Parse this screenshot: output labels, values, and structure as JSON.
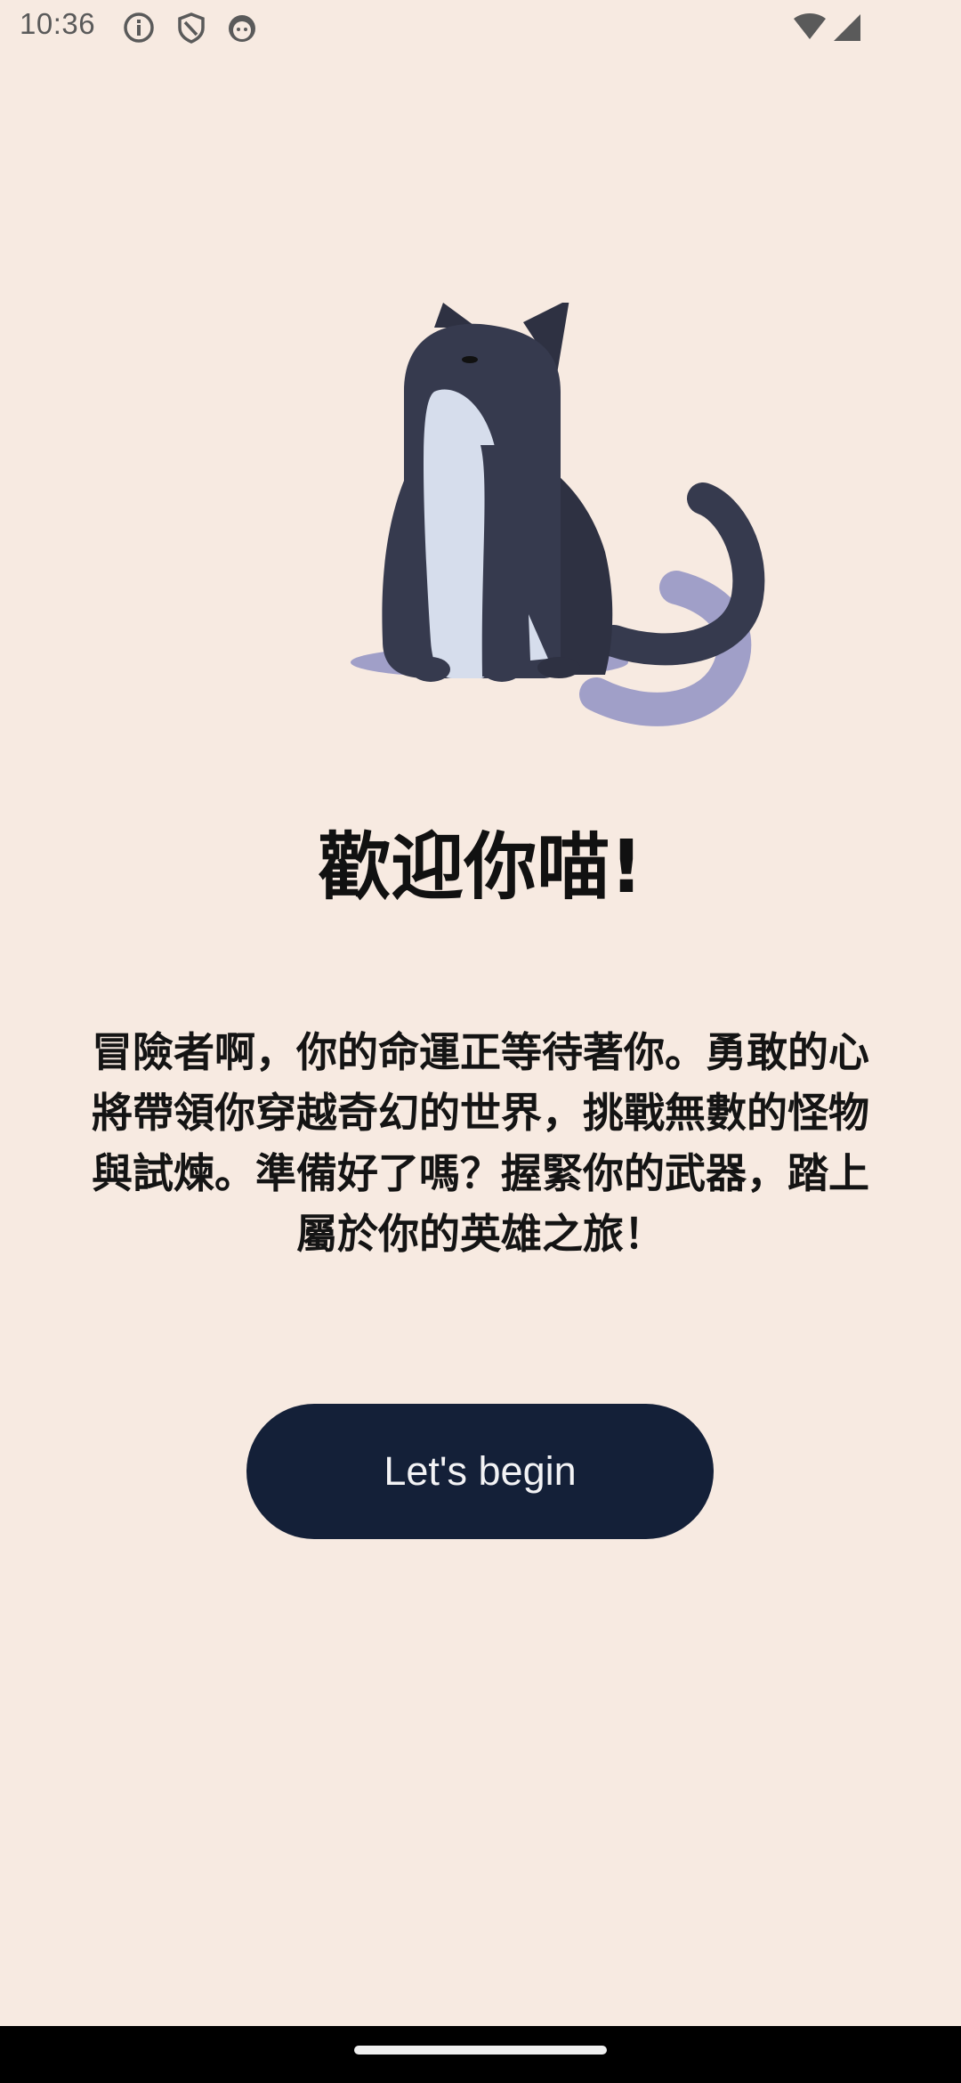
{
  "status_bar": {
    "time": "10:36",
    "icons": [
      "info-icon",
      "shield-icon",
      "android-face-icon"
    ],
    "right_icons": [
      "wifi-icon",
      "cell-signal-icon"
    ]
  },
  "hero": {
    "illustration": "cat-illustration"
  },
  "welcome": {
    "title": "歡迎你喵!",
    "body": "冒險者啊，你的命運正等待著你。勇敢的心將帶領你穿越奇幻的世界，挑戰無數的怪物與試煉。準備好了嗎？握緊你的武器，踏上屬於你的英雄之旅！"
  },
  "cta": {
    "label": "Let's begin"
  },
  "colors": {
    "background": "#F7EAE1",
    "button": "#142038",
    "button_text": "#F3F3F5",
    "cat_dark": "#363A4E",
    "cat_belly": "#D6DDEC",
    "cat_shadow": "#A09FC8"
  }
}
